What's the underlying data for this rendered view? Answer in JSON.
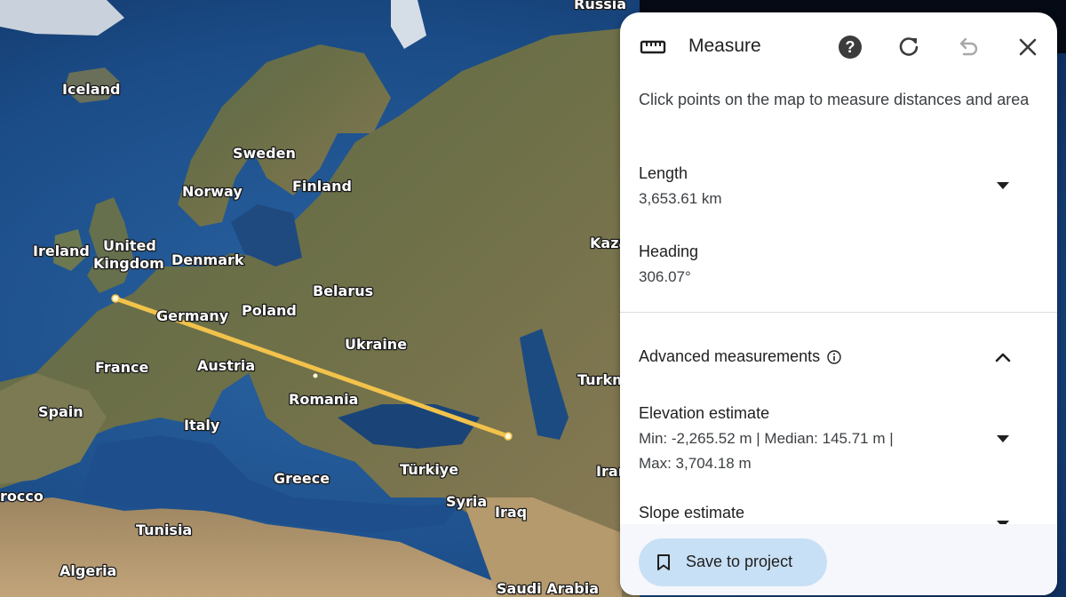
{
  "map": {
    "countries": [
      "Russia",
      "Iceland",
      "Sweden",
      "Norway",
      "Finland",
      "Ireland",
      "United",
      "Kingdom",
      "Denmark",
      "Belarus",
      "Poland",
      "Germany",
      "Ukraine",
      "France",
      "Austria",
      "Kaza",
      "Romania",
      "Turkm",
      "Spain",
      "Italy",
      "Türkiye",
      "Iran",
      "Greece",
      "Syria",
      "Iraq",
      "rocco",
      "Tunisia",
      "Algeria",
      "Saudi Arabia"
    ],
    "route_color": "#f2c24b",
    "ocean_color": "#1d4f8a",
    "land_color": "#5f6b45"
  },
  "panel": {
    "title": "Measure",
    "icons": [
      "ruler-icon",
      "help-icon",
      "refresh-icon",
      "undo-icon",
      "close-icon"
    ],
    "intro": "Click points on the map to measure distances and area",
    "length": {
      "label": "Length",
      "value": "3,653.61 km"
    },
    "heading": {
      "label": "Heading",
      "value": "306.07°"
    },
    "advanced": {
      "label": "Advanced measurements"
    },
    "elevation": {
      "label": "Elevation estimate",
      "value_line1": "Min: -2,265.52 m | Median: 145.71 m |",
      "value_line2": "Max: 3,704.18 m"
    },
    "slope": {
      "label": "Slope estimate"
    },
    "save_label": "Save to project",
    "accent": "#c8e0f5"
  }
}
